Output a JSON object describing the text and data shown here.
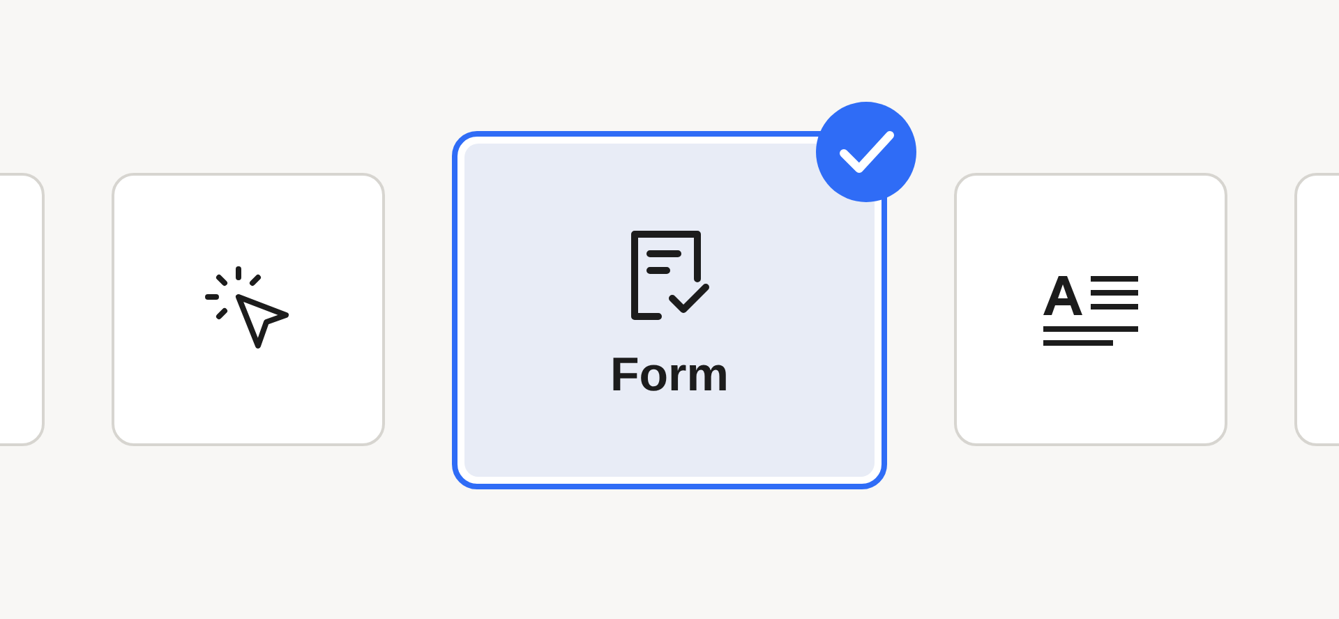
{
  "tiles": [
    {
      "kind": "blank",
      "selected": false
    },
    {
      "kind": "click",
      "selected": false
    },
    {
      "kind": "form",
      "selected": true,
      "label": "Form"
    },
    {
      "kind": "text",
      "selected": false
    },
    {
      "kind": "blank",
      "selected": false
    }
  ]
}
